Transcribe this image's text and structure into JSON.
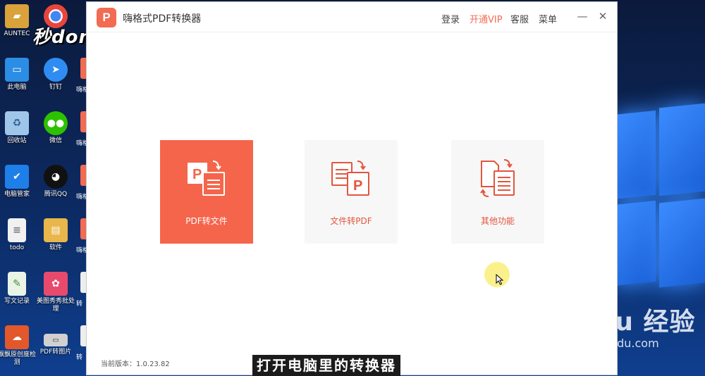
{
  "desktop": {
    "icons": [
      {
        "label": "AUNTEC",
        "icon": "folder-user-icon",
        "color": "#d9a23a"
      },
      {
        "label": "此电脑",
        "icon": "computer-icon",
        "color": "#2b8de3"
      },
      {
        "label": "回收站",
        "icon": "recycle-bin-icon",
        "color": "#9fc6e8"
      },
      {
        "label": "电脑管家",
        "icon": "shield-icon",
        "color": "#1f7fe8"
      },
      {
        "label": "todo",
        "icon": "document-icon",
        "color": "#f1f1f1"
      },
      {
        "label": "写文记录",
        "icon": "text-file-icon",
        "color": "#e9f3e6"
      },
      {
        "label": "飘飘原创度检测",
        "icon": "cloud-app-icon",
        "color": "#e2582b"
      },
      {
        "label": "",
        "icon": "chrome-icon",
        "color": "#e8453c"
      },
      {
        "label": "钉钉",
        "icon": "dingtalk-icon",
        "color": "#2f8cf2"
      },
      {
        "label": "微信",
        "icon": "wechat-icon",
        "color": "#2dc100"
      },
      {
        "label": "腾讯QQ",
        "icon": "qq-icon",
        "color": "#111111"
      },
      {
        "label": "软件",
        "icon": "folder-icon",
        "color": "#e8b64a"
      },
      {
        "label": "美图秀秀批处理",
        "icon": "meitu-icon",
        "color": "#e84a6e"
      },
      {
        "label": "PDF转图片",
        "icon": "pdf-image-icon",
        "color": "#d0d0d0"
      }
    ],
    "partial_labels": [
      "嗨格",
      "嗨格",
      "嗨格",
      "嗨格",
      "转",
      "转"
    ]
  },
  "watermarks": {
    "top_left": "秒dong视频",
    "baidu_main": "Bai du 经验",
    "baidu_url": "jingyan.baidu.com"
  },
  "app": {
    "logo_letter": "P",
    "title": "嗨格式PDF转换器",
    "menu": {
      "login": "登录",
      "vip": "开通VIP",
      "service": "客服",
      "menu": "菜单"
    },
    "window_controls": {
      "minimize": "—",
      "close": "✕"
    },
    "cards": [
      {
        "label": "PDF转文件",
        "icon": "pdf-to-file-icon",
        "selected": true
      },
      {
        "label": "文件转PDF",
        "icon": "file-to-pdf-icon",
        "selected": false
      },
      {
        "label": "其他功能",
        "icon": "other-functions-icon",
        "selected": false
      }
    ],
    "version_text": "当前版本：1.0.23.82",
    "accent_color": "#f5654b"
  },
  "subtitle": "打开电脑里的转换器"
}
